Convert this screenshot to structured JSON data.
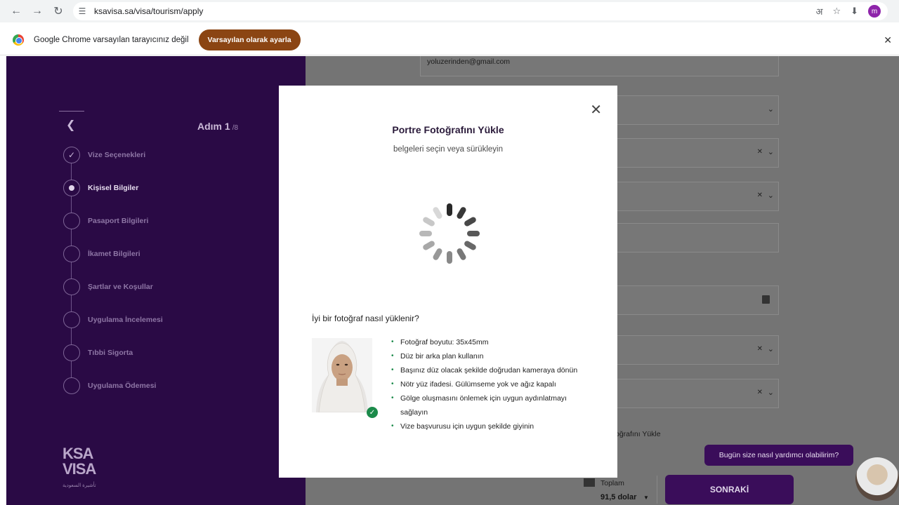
{
  "browser": {
    "url": "ksavisa.sa/visa/tourism/apply",
    "profile_initial": "m"
  },
  "infobar": {
    "message": "Google Chrome varsayılan tarayıcınız değil",
    "button": "Varsayılan olarak ayarla"
  },
  "sidebar": {
    "step_label": "Adım 1",
    "step_total": "/8",
    "steps": [
      {
        "label": "Vize Seçenekleri",
        "state": "done"
      },
      {
        "label": "Kişisel Bilgiler",
        "state": "active"
      },
      {
        "label": "Pasaport Bilgileri",
        "state": "pending"
      },
      {
        "label": "İkamet Bilgileri",
        "state": "pending"
      },
      {
        "label": "Şartlar ve Koşullar",
        "state": "pending"
      },
      {
        "label": "Uygulama İncelemesi",
        "state": "pending"
      },
      {
        "label": "Tıbbi Sigorta",
        "state": "pending"
      },
      {
        "label": "Uygulama Ödemesi",
        "state": "pending"
      }
    ],
    "logo_line1": "KSA",
    "logo_line2": "VISA",
    "logo_sub": "تأشيرة السعودية"
  },
  "form": {
    "email_value": "yoluzerinden@gmail.com",
    "upload_field_text": "oğrafını Yükle",
    "total_label": "Toplam",
    "total_value": "91,5 dolar",
    "next_button": "SONRAKİ",
    "chat_prompt": "Bugün size nasıl yardımcı olabilirim?"
  },
  "modal": {
    "title": "Portre Fotoğrafını Yükle",
    "subtitle": "belgeleri seçin veya sürükleyin",
    "how_title": "İyi bir fotoğraf nasıl yüklenir?",
    "tips": [
      "Fotoğraf boyutu: 35x45mm",
      "Düz bir arka plan kullanın",
      "Başınız düz olacak şekilde doğrudan kameraya dönün",
      "Nötr yüz ifadesi. Gülümseme yok ve ağız kapalı",
      "Gölge oluşmasını önlemek için uygun aydınlatmayı sağlayın",
      "Vize başvurusu için uygun şekilde giyinin"
    ]
  },
  "colors": {
    "sidebar_bg": "#2a0a45",
    "overlay": "#747474",
    "accent_purple": "#3a0d5a",
    "infobar_button": "#8b4513",
    "check_green": "#1b8a4a"
  },
  "icons": [
    "back-arrow-icon",
    "forward-arrow-icon",
    "reload-icon",
    "site-settings-icon",
    "translate-icon",
    "bookmark-star-icon",
    "download-icon",
    "close-icon",
    "chevron-down-icon",
    "calendar-icon",
    "loading-spinner-icon",
    "check-icon"
  ]
}
